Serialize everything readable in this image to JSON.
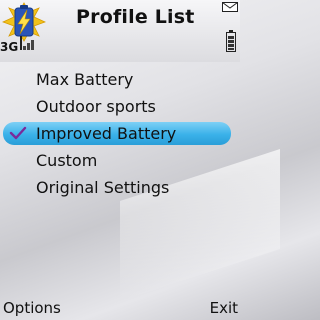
{
  "header": {
    "title": "Profile List",
    "network": "3G",
    "icons": {
      "app": "battery-lightning-icon",
      "message": "envelope-icon",
      "signal": "signal-bars-icon",
      "battery": "battery-level-icon"
    }
  },
  "profiles": {
    "items": [
      {
        "label": "Max Battery",
        "selected": false
      },
      {
        "label": "Outdoor sports",
        "selected": false
      },
      {
        "label": "Improved Battery",
        "selected": true
      },
      {
        "label": "Custom",
        "selected": false
      },
      {
        "label": "Original Settings",
        "selected": false
      }
    ]
  },
  "softkeys": {
    "left": "Options",
    "right": "Exit"
  },
  "colors": {
    "highlight": "#3ab1e9",
    "check": "#7a2a9a"
  }
}
